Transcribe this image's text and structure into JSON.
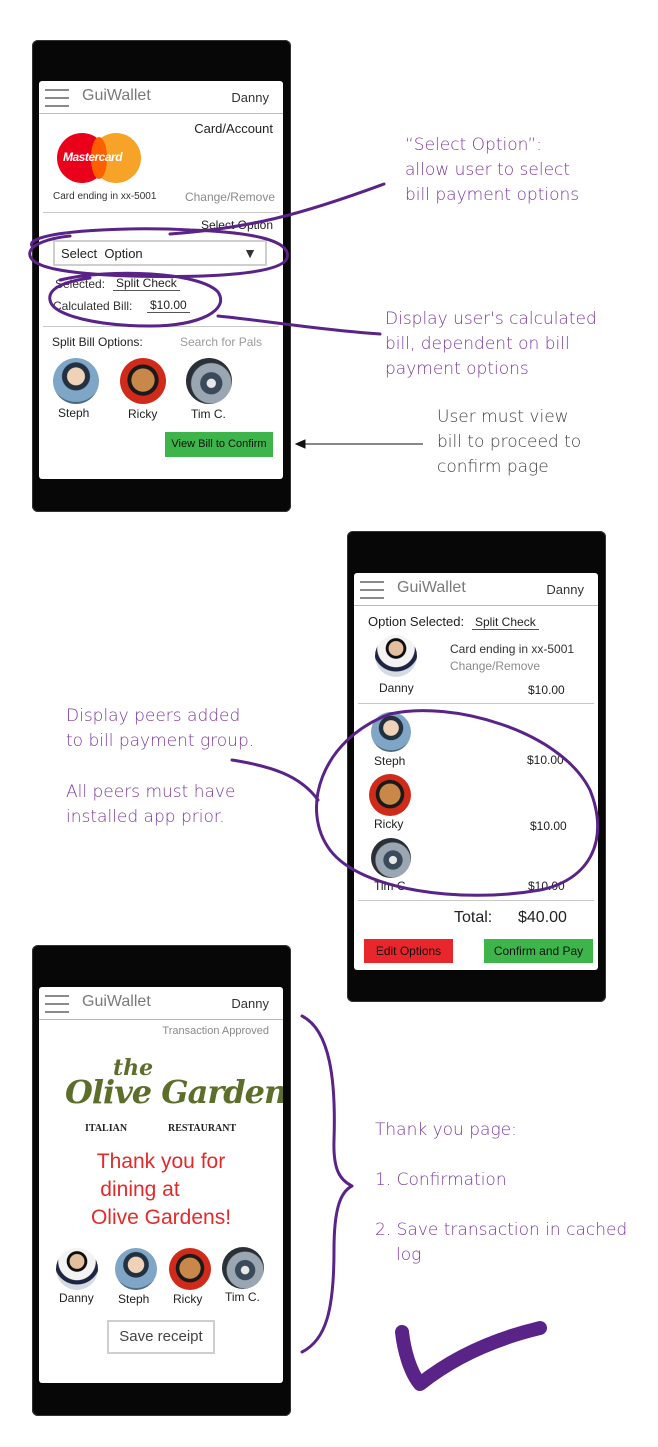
{
  "colors": {
    "accent_purple": "#6b2c91",
    "note_purple": "#7b3aa0",
    "button_green": "#3db54a",
    "button_red": "#e8262b",
    "thank_you_red": "#e32a2a",
    "olive_green": "#5c6e2a"
  },
  "screen1": {
    "header": {
      "brand": "GuiWallet",
      "user": "Danny",
      "menu_icon": "hamburger-menu-icon"
    },
    "card_section": {
      "title": "Card/Account",
      "card_brand": "Mastercard",
      "card_ending": "Card ending in xx-5001",
      "change_link": "Change/Remove"
    },
    "select_section": {
      "label": "Select Option",
      "dropdown_value": "Select  Option",
      "selected_label": "Selected:",
      "selected_value": "Split Check",
      "calc_label": "Calculated Bill:",
      "calc_value": "$10.00"
    },
    "split_section": {
      "title": "Split Bill Options:",
      "search_placeholder": "Search for Pals",
      "pals": [
        {
          "name": "Steph"
        },
        {
          "name": "Ricky"
        },
        {
          "name": "Tim C."
        }
      ]
    },
    "view_button": "View Bill to Confirm"
  },
  "screen2": {
    "header": {
      "brand": "GuiWallet",
      "user": "Danny"
    },
    "option_label": "Option Selected:",
    "option_value": "Split Check",
    "owner": {
      "name": "Danny",
      "card_ending": "Card ending in xx-5001",
      "change_link": "Change/Remove",
      "amount": "$10.00"
    },
    "peers": [
      {
        "name": "Steph",
        "amount": "$10.00"
      },
      {
        "name": "Ricky",
        "amount": "$10.00"
      },
      {
        "name": "Tim C.",
        "amount": "$10.00"
      }
    ],
    "total_label": "Total:",
    "total_value": "$40.00",
    "edit_button": "Edit Options",
    "confirm_button": "Confirm and Pay"
  },
  "screen3": {
    "header": {
      "brand": "GuiWallet",
      "user": "Danny"
    },
    "status": "Transaction Approved",
    "logo": {
      "the": "the",
      "name": "Olive Garden",
      "left": "ITALIAN",
      "right": "RESTAURANT"
    },
    "thank_you": [
      "Thank you for",
      "dining at",
      "Olive Gardens!"
    ],
    "people": [
      {
        "name": "Danny"
      },
      {
        "name": "Steph"
      },
      {
        "name": "Ricky"
      },
      {
        "name": "Tim C."
      }
    ],
    "save_button": "Save receipt"
  },
  "annotations": {
    "select_option": [
      "“Select Option”:",
      "allow user to select",
      "bill payment options"
    ],
    "calculated_bill": [
      "Display user's calculated",
      "bill, dependent on bill",
      "payment options"
    ],
    "view_bill": [
      "User must view",
      "bill to proceed to",
      "confirm page"
    ],
    "peers": [
      "Display peers added",
      "to bill payment group."
    ],
    "peers_note": [
      "All peers must have",
      "installed app prior."
    ],
    "thank_you": [
      "Thank you page:",
      "1. Confirmation",
      "2. Save transaction in cached",
      "log"
    ]
  }
}
